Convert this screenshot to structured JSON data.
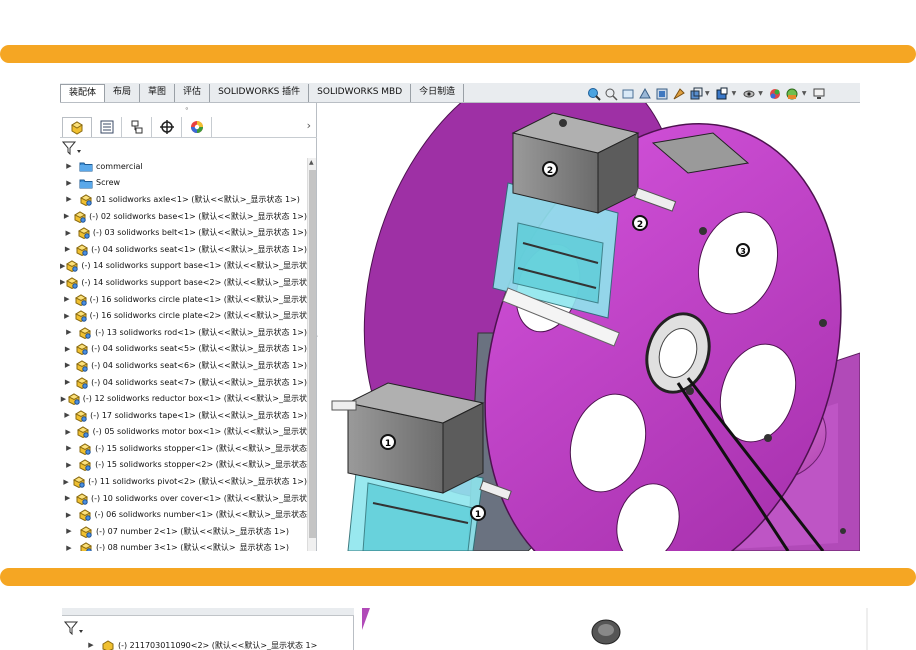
{
  "ribbon_tabs": [
    {
      "label": "装配体",
      "active": true
    },
    {
      "label": "布局",
      "active": false
    },
    {
      "label": "草图",
      "active": false
    },
    {
      "label": "评估",
      "active": false
    },
    {
      "label": "SOLIDWORKS 插件",
      "active": false
    },
    {
      "label": "SOLIDWORKS MBD",
      "active": false
    },
    {
      "label": "今日制造",
      "active": false
    }
  ],
  "hud_icons": [
    "magnify-icon",
    "zoom-area-icon",
    "previous-view-icon",
    "section-view-icon",
    "dynamic-annotation-icon",
    "view-orientation-icon",
    "display-style-icon",
    "hide-show-icon",
    "edit-appearance-icon",
    "apply-scene-icon",
    "view-settings-icon",
    "monitor-icon"
  ],
  "feature_manager_tabs": [
    "featuremanager-icon",
    "propertymanager-icon",
    "configurationmanager-icon",
    "dimxpert-icon",
    "display-manager-icon"
  ],
  "tree": {
    "items": [
      {
        "type": "folder",
        "label": "commercial"
      },
      {
        "type": "folder",
        "label": "Screw"
      },
      {
        "type": "part",
        "label": "01 solidworks axle<1> (默认<<默认>_显示状态 1>)"
      },
      {
        "type": "part",
        "label": "(-) 02 solidworks base<1> (默认<<默认>_显示状态 1>)"
      },
      {
        "type": "part",
        "label": "(-) 03 solidworks belt<1> (默认<<默认>_显示状态 1>)"
      },
      {
        "type": "part",
        "label": "(-) 04 solidworks seat<1> (默认<<默认>_显示状态 1>)"
      },
      {
        "type": "part",
        "label": "(-) 14 solidworks support base<1> (默认<<默认>_显示状"
      },
      {
        "type": "part",
        "label": "(-) 14 solidworks support base<2> (默认<<默认>_显示状"
      },
      {
        "type": "part",
        "label": "(-) 16 solidworks circle plate<1> (默认<<默认>_显示状"
      },
      {
        "type": "part",
        "label": "(-) 16 solidworks circle plate<2> (默认<<默认>_显示状"
      },
      {
        "type": "part",
        "label": "(-) 13 solidworks rod<1> (默认<<默认>_显示状态 1>)"
      },
      {
        "type": "part",
        "label": "(-) 04 solidworks seat<5> (默认<<默认>_显示状态 1>)"
      },
      {
        "type": "part",
        "label": "(-) 04 solidworks seat<6> (默认<<默认>_显示状态 1>)"
      },
      {
        "type": "part",
        "label": "(-) 04 solidworks seat<7> (默认<<默认>_显示状态 1>)"
      },
      {
        "type": "part",
        "label": "(-) 12 solidworks reductor box<1> (默认<<默认>_显示状"
      },
      {
        "type": "part",
        "label": "(-) 17 solidworks tape<1> (默认<<默认>_显示状态 1>)"
      },
      {
        "type": "part",
        "label": "(-) 05 solidworks motor box<1> (默认<<默认>_显示状"
      },
      {
        "type": "part",
        "label": "(-) 15 solidworks stopper<1> (默认<<默认>_显示状态"
      },
      {
        "type": "part",
        "label": "(-) 15 solidworks stopper<2> (默认<<默认>_显示状态"
      },
      {
        "type": "part",
        "label": "(-) 11 solidworks pivot<2> (默认<<默认>_显示状态 1>)"
      },
      {
        "type": "part",
        "label": "(-) 10 solidworks over cover<1> (默认<<默认>_显示状"
      },
      {
        "type": "part",
        "label": "(-) 06 solidworks number<1> (默认<<默认>_显示状态"
      },
      {
        "type": "part",
        "label": "(-) 07 number 2<1> (默认<<默认>_显示状态 1>)"
      },
      {
        "type": "part",
        "label": "(-) 08 number 3<1> (默认<<默认>_显示状态 1>)"
      }
    ]
  },
  "model_labels": {
    "n1": "1",
    "n2": "2",
    "n3": "3"
  },
  "second_window": {
    "row_label": "(-) 211703011090<2> (默认<<默认>_显示状态 1>"
  },
  "colors": {
    "accent_bar": "#f5a623",
    "plate": "#c040c8",
    "plate_dark": "#8e2f95",
    "box": "#7d7d7d",
    "seat_glass": "#8fe6ee"
  }
}
